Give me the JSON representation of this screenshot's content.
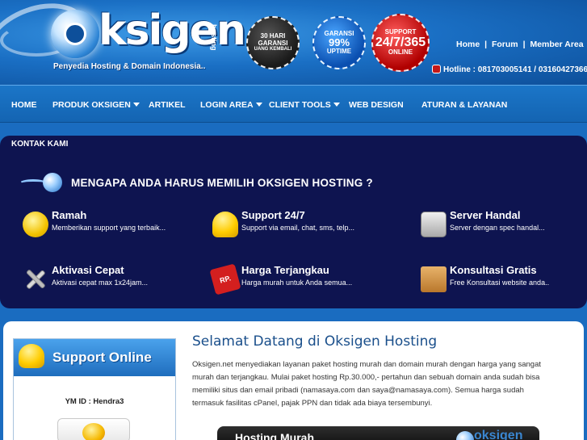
{
  "header": {
    "logo_text": "ksigen",
    "logo_side": "hosting",
    "tagline": "Penyedia Hosting & Domain Indonesia..",
    "badges": [
      {
        "l1": "30 HARI",
        "l2": "GARANSI",
        "l3": "UANG KEMBALI"
      },
      {
        "l1": "GARANSI",
        "l2": "99%",
        "l3": "UPTIME"
      },
      {
        "l1": "SUPPORT",
        "l2": "24/7/365",
        "l3": "ONLINE"
      }
    ],
    "links": [
      "Home",
      "Forum",
      "Member Area"
    ],
    "link_sep": "|",
    "hotline": "Hotline : 081703005141 / 03160427366"
  },
  "nav": {
    "items": [
      "HOME",
      "PRODUK OKSIGEN",
      "ARTIKEL",
      "LOGIN AREA",
      "CLIENT TOOLS",
      "WEB DESIGN",
      "ATURAN & LAYANAN"
    ]
  },
  "kontak": "KONTAK KAMI",
  "why": {
    "title": "MENGAPA ANDA HARUS MEMILIH OKSIGEN HOSTING ?",
    "features": [
      {
        "title": "Ramah",
        "desc": "Memberikan support yang terbaik...",
        "icon": "smiley-icon"
      },
      {
        "title": "Support 24/7",
        "desc": "Support via email, chat, sms, telp...",
        "icon": "helmet-icon"
      },
      {
        "title": "Server Handal",
        "desc": "Server dengan spec handal...",
        "icon": "server-icon"
      },
      {
        "title": "Aktivasi Cepat",
        "desc": "Aktivasi cepat max 1x24jam...",
        "icon": "tools-icon"
      },
      {
        "title": "Harga Terjangkau",
        "desc": "Harga murah untuk Anda semua...",
        "icon": "price-tag-icon"
      },
      {
        "title": "Konsultasi Gratis",
        "desc": "Free Konsultasi website anda..",
        "icon": "box-icon"
      }
    ],
    "price_tag_label": "RP."
  },
  "support": {
    "title": "Support Online",
    "ym_id": "YM ID : Hendra3"
  },
  "welcome": {
    "title": "Selamat Datang di Oksigen Hosting",
    "text": "Oksigen.net menyediakan layanan paket hosting murah dan domain murah dengan harga yang sangat murah dan terjangkau. Mulai paket hosting Rp.30.000,- pertahun dan sebuah domain anda sudah bisa memiliki situs dan email pribadi (namasaya.com dan saya@namasaya.com). Semua harga sudah termasuk fasilitas cPanel, pajak PPN dan tidak ada biaya tersembunyi."
  },
  "banner": {
    "title": "Hosting Murah",
    "logo": "oksigen"
  }
}
